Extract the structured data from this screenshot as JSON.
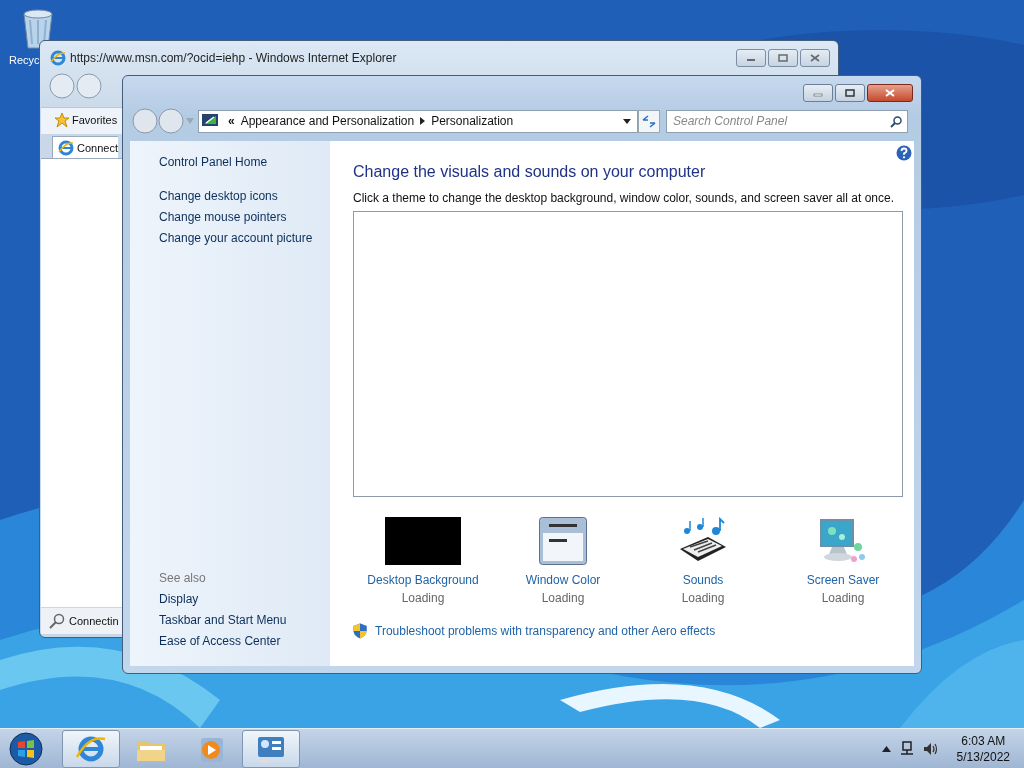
{
  "desktop": {
    "icons": [
      {
        "label": "Recyc"
      }
    ]
  },
  "ie_window": {
    "title": "https://www.msn.com/?ocid=iehp - Windows Internet Explorer",
    "favorites": "Favorites",
    "tab": "Connect",
    "status": "Connectin"
  },
  "control_panel": {
    "breadcrumb": {
      "overflow": "«",
      "items": [
        "Appearance and Personalization",
        "Personalization"
      ]
    },
    "search": {
      "placeholder": "Search Control Panel"
    },
    "sidebar": {
      "home": "Control Panel Home",
      "links": [
        "Change desktop icons",
        "Change mouse pointers",
        "Change your account picture"
      ],
      "see_also": "See also",
      "see_also_links": [
        "Display",
        "Taskbar and Start Menu",
        "Ease of Access Center"
      ]
    },
    "heading": "Change the visuals and sounds on your computer",
    "description": "Click a theme to change the desktop background, window color, sounds, and screen saver all at once.",
    "items": [
      {
        "kind": "background",
        "label": "Desktop Background",
        "status": "Loading"
      },
      {
        "kind": "color",
        "label": "Window Color",
        "status": "Loading"
      },
      {
        "kind": "sounds",
        "label": "Sounds",
        "status": "Loading"
      },
      {
        "kind": "saver",
        "label": "Screen Saver",
        "status": "Loading"
      }
    ],
    "troubleshoot": "Troubleshoot problems with transparency and other Aero effects"
  },
  "taskbar": {
    "buttons": [
      {
        "kind": "ie",
        "open": true
      },
      {
        "kind": "explorer",
        "open": false
      },
      {
        "kind": "media",
        "open": false
      },
      {
        "kind": "control",
        "open": true
      }
    ],
    "time": "6:03 AM",
    "date": "5/13/2022"
  }
}
